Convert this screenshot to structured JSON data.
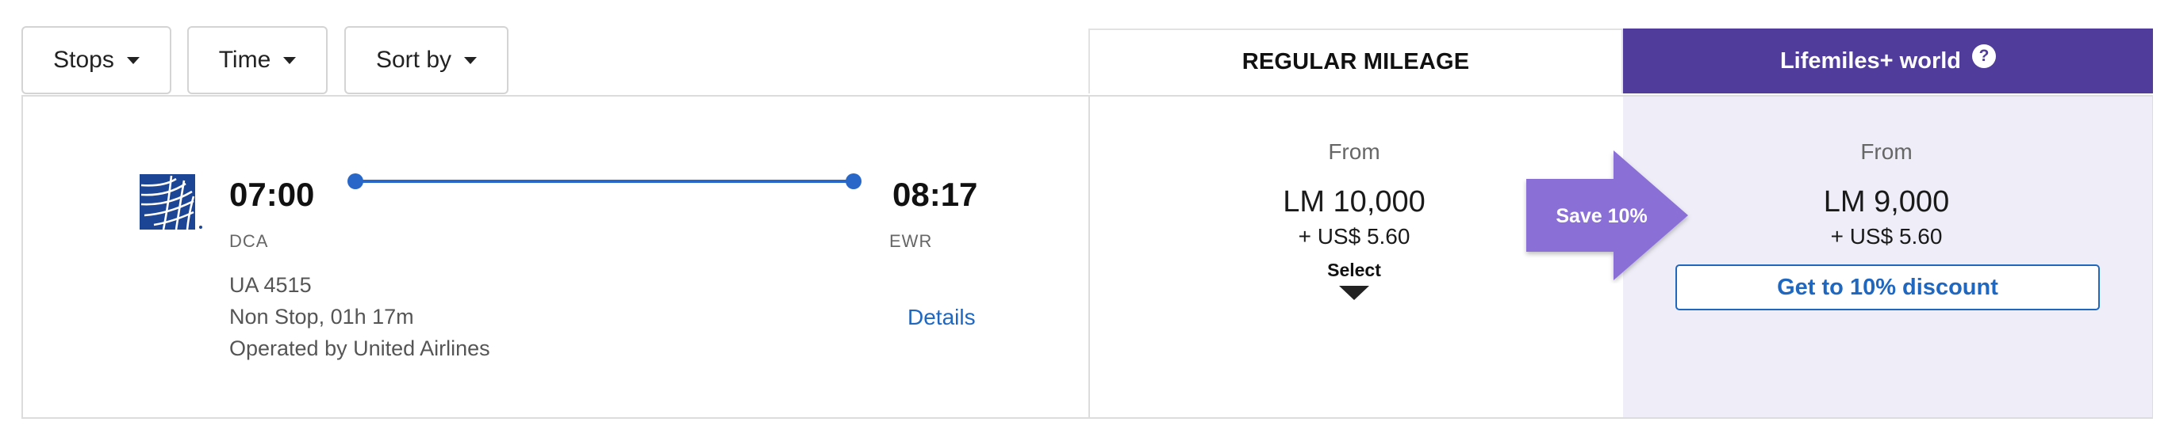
{
  "filters": {
    "stops_label": "Stops",
    "time_label": "Time",
    "sort_label": "Sort by"
  },
  "columns": {
    "regular_label": "REGULAR MILEAGE",
    "plus_label": "Lifemiles+ world",
    "help_glyph": "?"
  },
  "flight": {
    "airline_logo": "united-airlines-globe-logo",
    "departure_time": "07:00",
    "arrival_time": "08:17",
    "departure_code": "DCA",
    "arrival_code": "EWR",
    "flight_number": "UA 4515",
    "duration": "Non Stop, 01h 17m",
    "operator": "Operated by United Airlines",
    "details_label": "Details"
  },
  "regular_price": {
    "from_label": "From",
    "miles": "LM 10,000",
    "tax": "+ US$ 5.60",
    "select_label": "Select"
  },
  "plus_price": {
    "from_label": "From",
    "miles": "LM 9,000",
    "tax": "+ US$ 5.60",
    "discount_button": "Get to 10% discount"
  },
  "badge": {
    "save_label": "Save 10%"
  },
  "colors": {
    "brand_purple": "#4f3c9b",
    "badge_purple": "#8a6fd6",
    "plus_panel_bg": "#efeef8",
    "link_blue": "#2067c0",
    "route_blue": "#2867c7",
    "united_blue": "#1d4596"
  }
}
